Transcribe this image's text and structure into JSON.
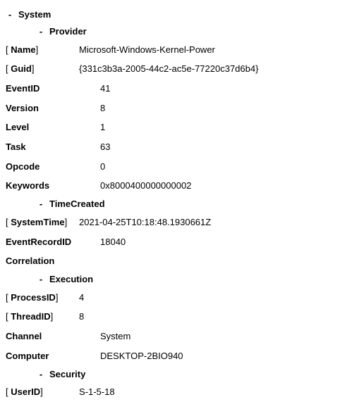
{
  "toggle": "-",
  "root": {
    "label": "System",
    "children": {
      "provider": {
        "label": "Provider",
        "attrs": {
          "name": {
            "label": "Name",
            "value": "Microsoft-Windows-Kernel-Power"
          },
          "guid": {
            "label": "Guid",
            "value": "{331c3b3a-2005-44c2-ac5e-77220c37d6b4}"
          }
        }
      },
      "eventid": {
        "label": "EventID",
        "value": "41"
      },
      "version": {
        "label": "Version",
        "value": "8"
      },
      "level": {
        "label": "Level",
        "value": "1"
      },
      "task": {
        "label": "Task",
        "value": "63"
      },
      "opcode": {
        "label": "Opcode",
        "value": "0"
      },
      "keywords": {
        "label": "Keywords",
        "value": "0x8000400000000002"
      },
      "timecreated": {
        "label": "TimeCreated",
        "attrs": {
          "systemtime": {
            "label": "SystemTime",
            "value": "2021-04-25T10:18:48.1930661Z"
          }
        }
      },
      "eventrecordid": {
        "label": "EventRecordID",
        "value": "18040"
      },
      "correlation": {
        "label": "Correlation"
      },
      "execution": {
        "label": "Execution",
        "attrs": {
          "processid": {
            "label": "ProcessID",
            "value": "4"
          },
          "threadid": {
            "label": "ThreadID",
            "value": "8"
          }
        }
      },
      "channel": {
        "label": "Channel",
        "value": "System"
      },
      "computer": {
        "label": "Computer",
        "value": "DESKTOP-2BIO940"
      },
      "security": {
        "label": "Security",
        "attrs": {
          "userid": {
            "label": "UserID",
            "value": "S-1-5-18"
          }
        }
      }
    }
  }
}
